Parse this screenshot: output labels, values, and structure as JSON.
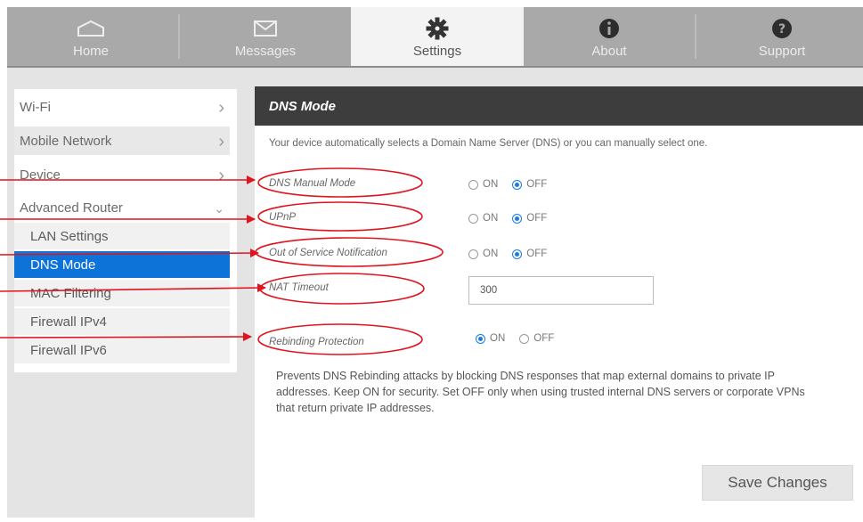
{
  "tabs": [
    {
      "label": "Home",
      "icon": "home-icon"
    },
    {
      "label": "Messages",
      "icon": "envelope-icon"
    },
    {
      "label": "Settings",
      "icon": "gear-icon"
    },
    {
      "label": "About",
      "icon": "info-icon"
    },
    {
      "label": "Support",
      "icon": "question-icon"
    }
  ],
  "active_tab": "Settings",
  "sidebar": {
    "items": [
      {
        "label": "Wi-Fi"
      },
      {
        "label": "Mobile Network"
      },
      {
        "label": "Device"
      },
      {
        "label": "Advanced Router"
      }
    ],
    "subitems": [
      {
        "label": "LAN Settings"
      },
      {
        "label": "DNS Mode"
      },
      {
        "label": "MAC Filtering"
      },
      {
        "label": "Firewall IPv4"
      },
      {
        "label": "Firewall IPv6"
      }
    ],
    "active_subitem": "DNS Mode"
  },
  "panel": {
    "title": "DNS Mode",
    "description": "Your device automatically selects a Domain Name Server (DNS) or you can manually select one.",
    "settings": [
      {
        "label": "DNS Manual Mode",
        "on_label": "ON",
        "off_label": "OFF",
        "value": "OFF"
      },
      {
        "label": "UPnP",
        "on_label": "ON",
        "off_label": "OFF",
        "value": "OFF"
      },
      {
        "label": "Out of Service Notification",
        "on_label": "ON",
        "off_label": "OFF",
        "value": "OFF"
      },
      {
        "label": "NAT Timeout",
        "input_value": "300"
      },
      {
        "label": "Rebinding Protection",
        "on_label": "ON",
        "off_label": "OFF",
        "value": "ON"
      }
    ],
    "help_text": "Prevents DNS Rebinding attacks by blocking DNS responses that map external domains to private IP addresses. Keep ON for security. Set OFF only when using trusted internal DNS servers or corporate VPNs that return private IP addresses.",
    "save_label": "Save Changes"
  },
  "colors": {
    "accent": "#0d73d9",
    "annotation": "#e0141e",
    "header_bg": "#3d3d3d",
    "tabbar_bg": "#a9a9a9"
  }
}
